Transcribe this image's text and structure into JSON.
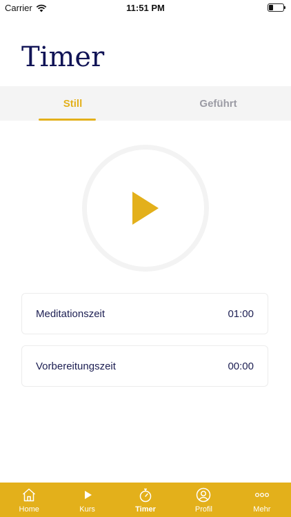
{
  "status_bar": {
    "carrier": "Carrier",
    "time": "11:51 PM",
    "icons": [
      "wifi-icon",
      "battery-icon"
    ]
  },
  "page": {
    "title": "Timer"
  },
  "tabs": [
    {
      "label": "Still",
      "active": true
    },
    {
      "label": "Geführt",
      "active": false
    }
  ],
  "player": {
    "icon": "play-icon"
  },
  "settings": [
    {
      "label": "Meditationszeit",
      "value": "01:00"
    },
    {
      "label": "Vorbereitungszeit",
      "value": "00:00"
    }
  ],
  "bottom_nav": [
    {
      "label": "Home",
      "icon": "home-icon",
      "active": false
    },
    {
      "label": "Kurs",
      "icon": "play-icon",
      "active": false
    },
    {
      "label": "Timer",
      "icon": "stopwatch-icon",
      "active": true
    },
    {
      "label": "Profil",
      "icon": "profile-icon",
      "active": false
    },
    {
      "label": "Mehr",
      "icon": "more-icon",
      "active": false
    }
  ],
  "colors": {
    "accent": "#e3b01b",
    "title": "#111456",
    "text": "#1c1e52",
    "inactive_tab": "#9b9ba4",
    "tab_background": "#f4f4f4"
  }
}
